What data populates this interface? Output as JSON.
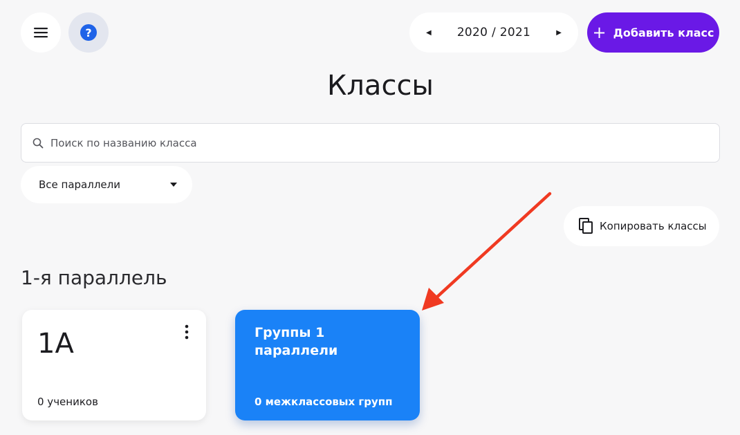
{
  "header": {
    "menu_icon": "hamburger-icon",
    "help_icon": "question-icon",
    "help_glyph": "?",
    "year": {
      "label": "2020 / 2021",
      "prev_icon": "triangle-left-icon",
      "next_icon": "triangle-right-icon"
    },
    "add_button": {
      "icon": "plus-icon",
      "label": "Добавить класс"
    }
  },
  "page_title": "Классы",
  "search": {
    "placeholder": "Поиск по названию класса",
    "value": ""
  },
  "filter": {
    "selected": "Все параллели"
  },
  "copy_button": {
    "icon": "copy-icon",
    "label": "Копировать классы"
  },
  "section": {
    "title": "1-я параллель",
    "class_card": {
      "name": "1А",
      "students": "0 учеников"
    },
    "group_card": {
      "title": "Группы 1 параллели",
      "count": "0 межклассовых групп"
    }
  },
  "colors": {
    "accent_purple": "#6a19e6",
    "group_blue": "#1a82f7",
    "help_blue": "#1f63e8",
    "arrow_red": "#f03a22"
  }
}
